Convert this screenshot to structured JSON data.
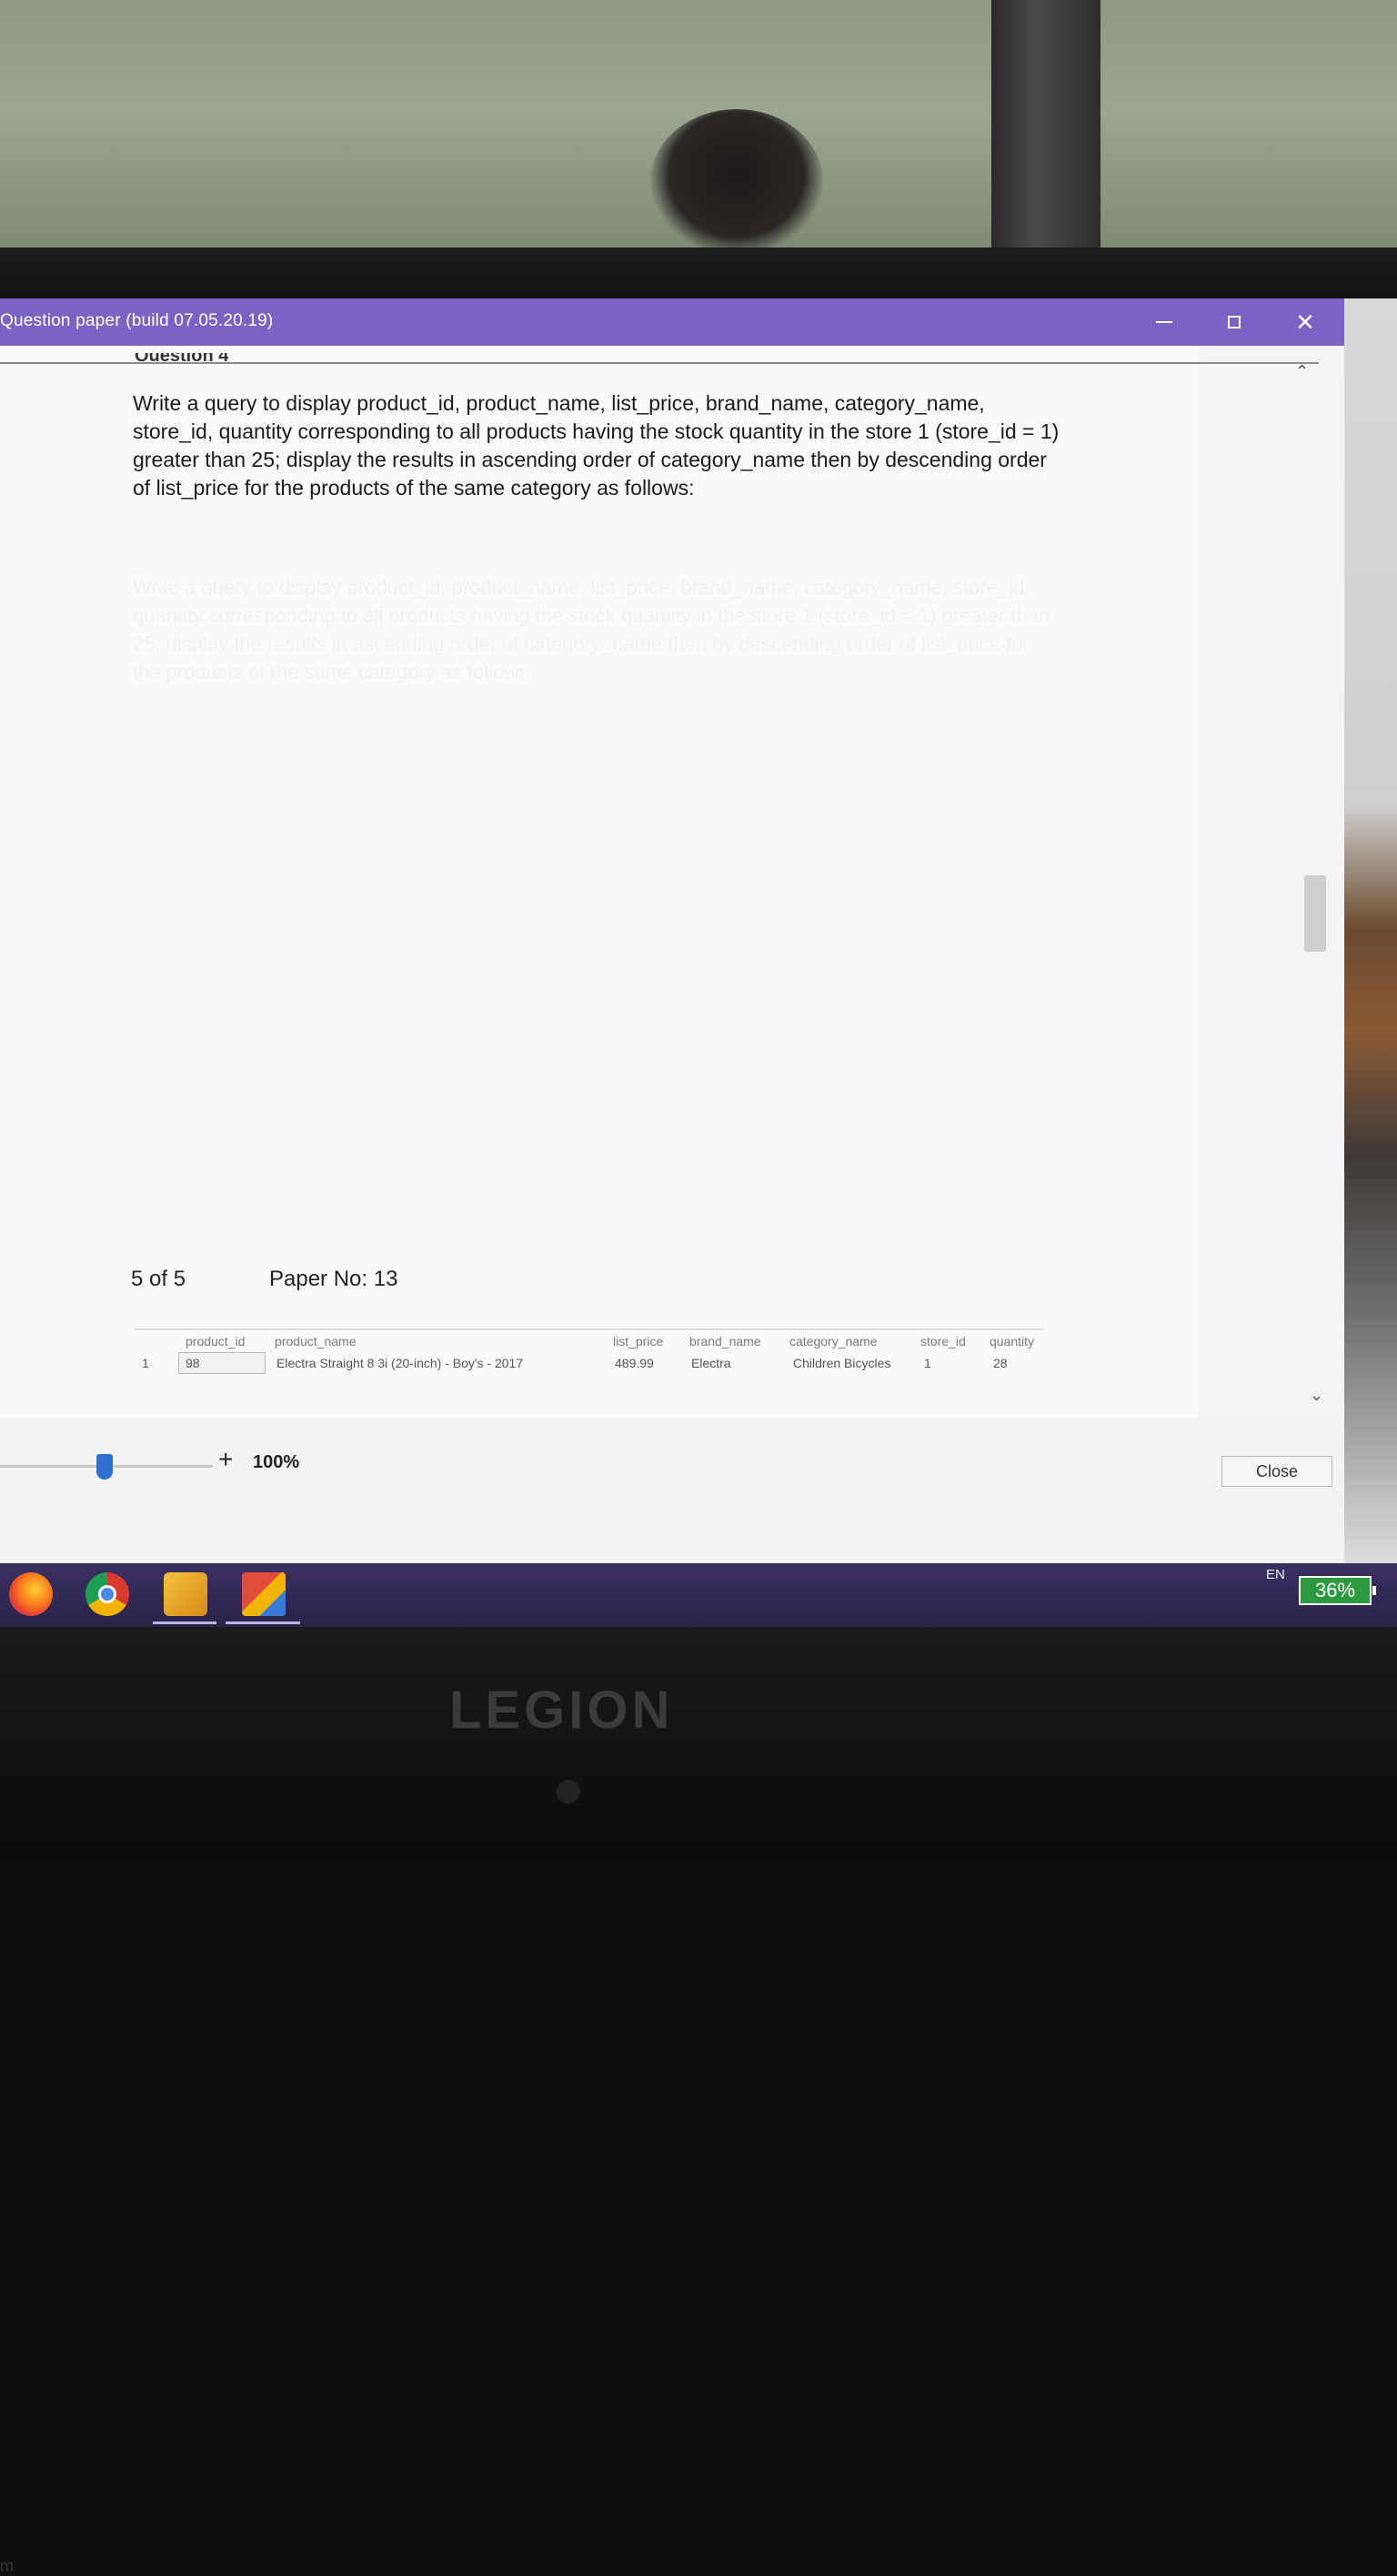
{
  "window": {
    "title": "Question paper (build 07.05.20.19)",
    "controls": [
      "minimize",
      "maximize",
      "close"
    ]
  },
  "question": {
    "text": "Write a query to display product_id, product_name, list_price, brand_name, category_name, store_id, quantity  corresponding to all products having the stock quantity in the store 1 (store_id = 1) greater than 25; display the results in ascending order of category_name then by descending order of list_price for the products of the same category as follows:"
  },
  "footer": {
    "pager": "5 of 5",
    "paper_no": "Paper No: 13"
  },
  "result_table": {
    "columns": [
      "product_id",
      "product_name",
      "list_price",
      "brand_name",
      "category_name",
      "store_id",
      "quantity"
    ],
    "rows": [
      {
        "row_index": "1",
        "product_id": "98",
        "product_name": "Electra Straight 8 3i (20-inch) - Boy's - 2017",
        "list_price": "489.99",
        "brand_name": "Electra",
        "category_name": "Children Bicycles",
        "store_id": "1",
        "quantity": "28"
      }
    ]
  },
  "toolbar": {
    "zoom_level": "100%",
    "zoom_plus": "+",
    "close_label": "Close",
    "left_mark": "m"
  },
  "taskbar": {
    "language": "EN",
    "battery": "36%",
    "icons": [
      "firefox-icon",
      "chrome-icon",
      "tool-icon",
      "app-icon"
    ]
  },
  "device": {
    "brand": "LEGION"
  },
  "icons": {
    "scroll_up": "chevron-up-icon",
    "scroll_down": "chevron-down-icon",
    "colors": {
      "titlebar": "#7b63c4",
      "zoom_handle": "#2f6fd2",
      "battery": "#2e9a3f"
    }
  }
}
